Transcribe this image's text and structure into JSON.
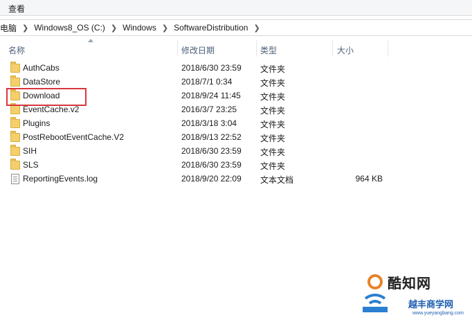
{
  "ribbon": {
    "tab_view": "查看"
  },
  "address": {
    "crumbs": [
      "电脑",
      "Windows8_OS (C:)",
      "Windows",
      "SoftwareDistribution"
    ]
  },
  "columns": {
    "name": "名称",
    "date": "修改日期",
    "type": "类型",
    "size": "大小"
  },
  "files": [
    {
      "name": "AuthCabs",
      "date": "2018/6/30 23:59",
      "type": "文件夹",
      "size": "",
      "icon": "folder-icon"
    },
    {
      "name": "DataStore",
      "date": "2018/7/1 0:34",
      "type": "文件夹",
      "size": "",
      "icon": "folder-icon"
    },
    {
      "name": "Download",
      "date": "2018/9/24 11:45",
      "type": "文件夹",
      "size": "",
      "icon": "folder-icon"
    },
    {
      "name": "EventCache.v2",
      "date": "2016/3/7 23:25",
      "type": "文件夹",
      "size": "",
      "icon": "folder-icon"
    },
    {
      "name": "Plugins",
      "date": "2018/3/18 3:04",
      "type": "文件夹",
      "size": "",
      "icon": "folder-icon"
    },
    {
      "name": "PostRebootEventCache.V2",
      "date": "2018/9/13 22:52",
      "type": "文件夹",
      "size": "",
      "icon": "folder-icon"
    },
    {
      "name": "SIH",
      "date": "2018/6/30 23:59",
      "type": "文件夹",
      "size": "",
      "icon": "folder-icon"
    },
    {
      "name": "SLS",
      "date": "2018/6/30 23:59",
      "type": "文件夹",
      "size": "",
      "icon": "folder-icon"
    },
    {
      "name": "ReportingEvents.log",
      "date": "2018/9/20 22:09",
      "type": "文本文档",
      "size": "964 KB",
      "icon": "text-file-icon"
    }
  ],
  "highlight_color": "#d9363e",
  "watermark": {
    "cn": "酷知网",
    "sub": "越丰商学网",
    "url": "www.yueyangbang.com"
  }
}
